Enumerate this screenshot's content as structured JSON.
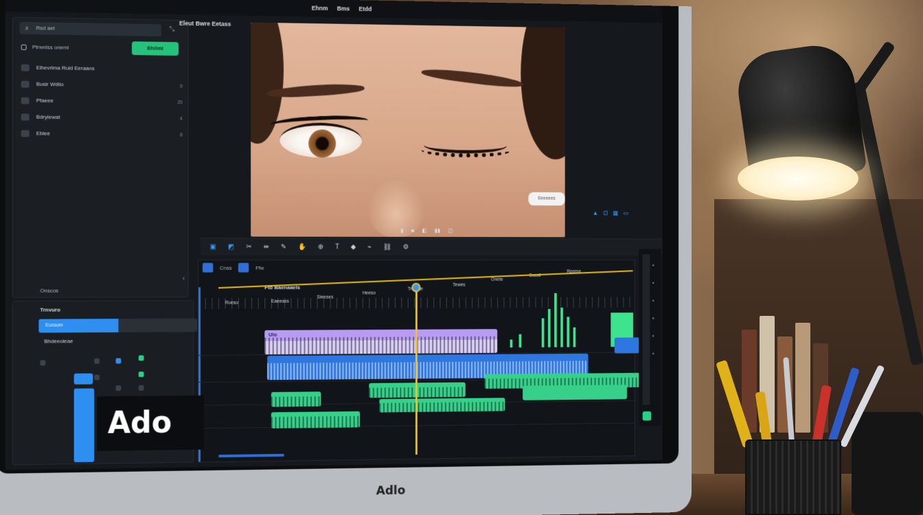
{
  "app": {
    "menu": [
      "Ehnm",
      "Bms",
      "Etdd"
    ]
  },
  "media_panel": {
    "search_placeholder": "Rsd aet",
    "filter_label": "Ptrwnlss oneml",
    "green_button": "Ehilml",
    "items": [
      {
        "label": "Elhevrlma Ruld Eeraans",
        "count": ""
      },
      {
        "label": "Busir Wdlio",
        "count": "6"
      },
      {
        "label": "Pfaeee",
        "count": "20"
      },
      {
        "label": "Bdryiewat",
        "count": "4"
      },
      {
        "label": "Eblee",
        "count": "8"
      }
    ],
    "footer": "Onscos"
  },
  "viewer": {
    "title": "Eleut Bwre Eetass",
    "badge": "Eeeeees"
  },
  "timeline": {
    "tab1": "Cnss",
    "tab2": "Ffw",
    "label": "Fto Baenaaels",
    "timecodes": [
      "Roeso",
      "Eaeeass",
      "Sieeses",
      "Heeso",
      "Treeme",
      "Tewes",
      "Onete",
      "Sossll",
      "Reeme"
    ],
    "clip_label": "Uio"
  },
  "lower_panel": {
    "title": "Trnvuro",
    "progress_label": "Eunsom",
    "progress": 0.5,
    "subtitle": "Bhdeeoieae",
    "big_text": "Ado"
  },
  "monitor": {
    "brand": "Adlo"
  },
  "colors": {
    "accent_blue": "#2f8ff0",
    "accent_green": "#2ad086",
    "clip_purple": "#b79cf2",
    "playhead_yellow": "#f3c21b"
  }
}
